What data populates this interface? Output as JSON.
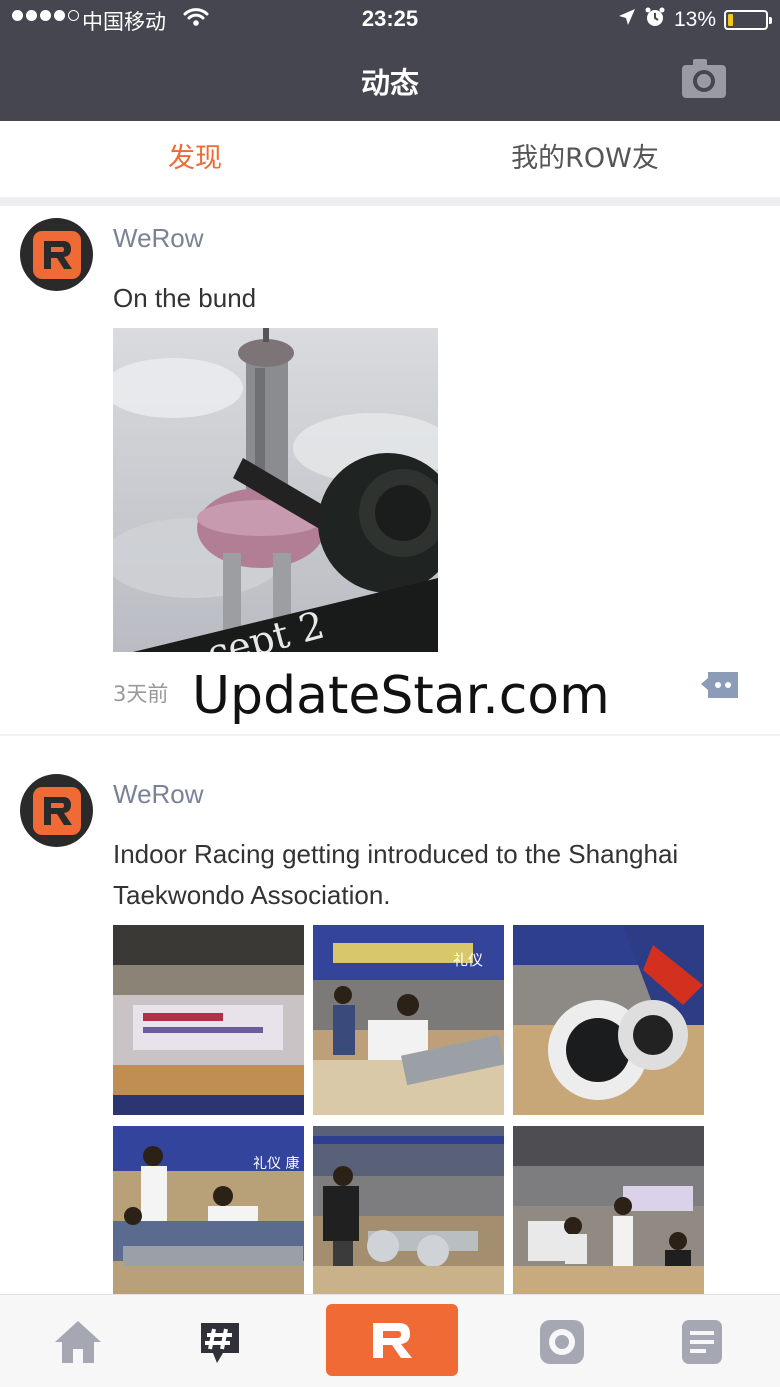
{
  "status_bar": {
    "carrier": "中国移动",
    "time": "23:25",
    "battery": "13%",
    "battery_level": 0.13
  },
  "header": {
    "title": "动态",
    "camera_icon": "camera-icon"
  },
  "tabs": [
    {
      "label": "发现",
      "active": true
    },
    {
      "label": "我的ROW友",
      "active": false
    }
  ],
  "posts": [
    {
      "author": "WeRow",
      "text": "On the bund",
      "time": "3天前",
      "watermark": "UpdateStar.com",
      "photo_text": "cept 2"
    },
    {
      "author": "WeRow",
      "text": "Indoor Racing getting introduced to the Shanghai Taekwondo Association.",
      "photo_labels": [
        "礼仪",
        "礼仪 康"
      ]
    }
  ],
  "bottom_nav": [
    {
      "icon": "home-icon"
    },
    {
      "icon": "hashtag-chat-icon"
    },
    {
      "icon": "werow-logo-icon",
      "label": "R"
    },
    {
      "icon": "record-icon"
    },
    {
      "icon": "list-icon"
    }
  ],
  "colors": {
    "accent": "#ef6a34",
    "header_bg": "#45464f",
    "author": "#7a8296"
  }
}
